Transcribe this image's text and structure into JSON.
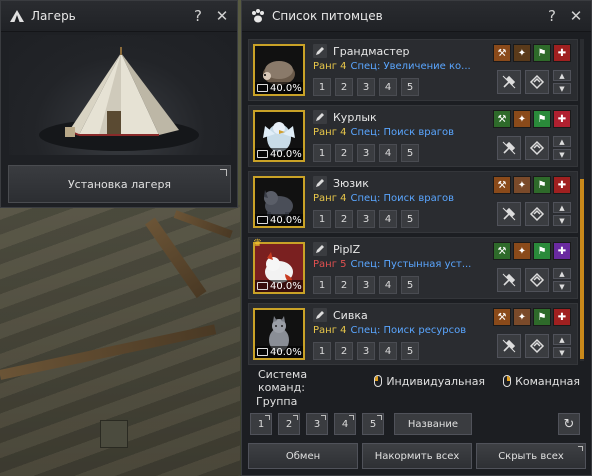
{
  "camp_window": {
    "title": "Лагерь",
    "help": "?",
    "close": "✕",
    "install_button": "Установка лагеря"
  },
  "pets_window": {
    "title": "Список питомцев",
    "help": "?",
    "close": "✕",
    "pets": [
      {
        "name": "Грандмастер",
        "rank": "Ранг 4",
        "spec": "Спец: Увеличение ко...",
        "food": "40.0%",
        "rank_color": "#e8c74a",
        "crowned": false,
        "skills": [
          "#8a4a1a",
          "#5a3a1a",
          "#2e6a2a",
          "#a02020"
        ],
        "animal": "hedgehog"
      },
      {
        "name": "Курлык",
        "rank": "Ранг 4",
        "spec": "Спец: Поиск врагов",
        "food": "40.0%",
        "rank_color": "#e8c74a",
        "crowned": false,
        "skills": [
          "#2e6a2a",
          "#8a4a1a",
          "#2a8a3a",
          "#b02030"
        ],
        "animal": "griffin"
      },
      {
        "name": "Зюзик",
        "rank": "Ранг 4",
        "spec": "Спец: Поиск врагов",
        "food": "40.0%",
        "rank_color": "#e8c74a",
        "crowned": false,
        "skills": [
          "#8a4a1a",
          "#7a4a2a",
          "#2e6a2a",
          "#a02020"
        ],
        "animal": "dog"
      },
      {
        "name": "PipIZ",
        "rank": "Ранг 5",
        "spec": "Спец: Пустынная уст...",
        "food": "40.0%",
        "rank_color": "#e05050",
        "crowned": true,
        "skills": [
          "#2e6a2a",
          "#8a4a1a",
          "#2a8a3a",
          "#6a2aa0"
        ],
        "animal": "fox"
      },
      {
        "name": "Сивка",
        "rank": "Ранг 4",
        "spec": "Спец: Поиск ресурсов",
        "food": "40.0%",
        "rank_color": "#e8c74a",
        "crowned": false,
        "skills": [
          "#8a4a1a",
          "#7a4a2a",
          "#2e6a2a",
          "#a02020"
        ],
        "animal": "cat"
      }
    ],
    "num_buttons": [
      "1",
      "2",
      "3",
      "4",
      "5"
    ],
    "command_system": {
      "label": "Система команд:",
      "individual": "Индивидуальная",
      "team": "Командная"
    },
    "group": {
      "label": "Группа",
      "buttons": [
        "1",
        "2",
        "3",
        "4",
        "5"
      ],
      "name_button": "Название"
    },
    "bottom": {
      "exchange": "Обмен",
      "feed_all": "Накормить всех",
      "hide_all": "Скрыть всех"
    }
  },
  "colors": {
    "accent": "#c9891a",
    "rank_gold": "#e8c74a",
    "spec_blue": "#5aa6ff"
  }
}
